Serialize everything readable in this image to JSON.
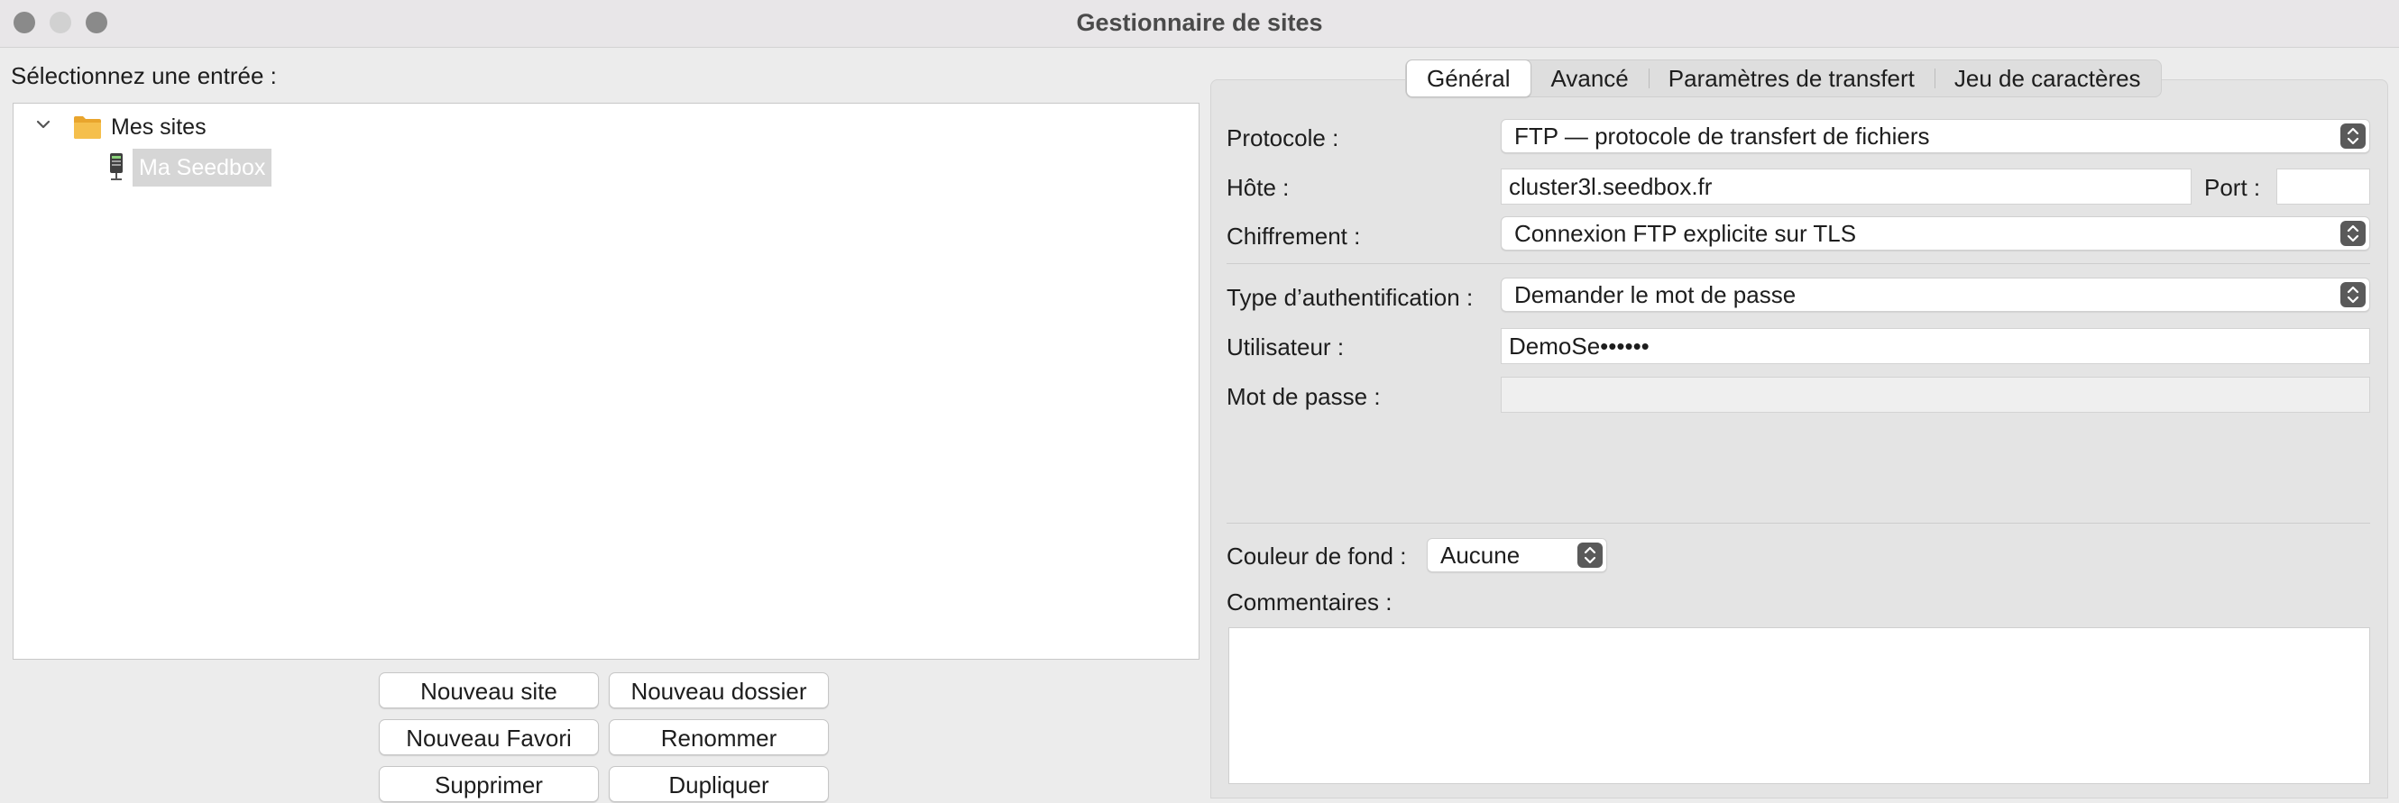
{
  "window": {
    "title": "Gestionnaire de sites"
  },
  "left": {
    "select_label": "Sélectionnez une entrée :",
    "tree": {
      "folder_label": "Mes sites",
      "site_label": "Ma Seedbox"
    },
    "buttons": {
      "new_site": "Nouveau site",
      "new_folder": "Nouveau dossier",
      "new_bookmark": "Nouveau Favori",
      "rename": "Renommer",
      "delete": "Supprimer",
      "duplicate": "Dupliquer"
    }
  },
  "tabs": [
    "Général",
    "Avancé",
    "Paramètres de transfert",
    "Jeu de caractères"
  ],
  "general": {
    "protocol_label": "Protocole :",
    "protocol_value": "FTP — protocole de transfert de fichiers",
    "host_label": "Hôte :",
    "host_value": "cluster3l.seedbox.fr",
    "port_label": "Port :",
    "port_value": "",
    "encryption_label": "Chiffrement :",
    "encryption_value": "Connexion FTP explicite sur TLS",
    "auth_label": "Type d’authentification :",
    "auth_value": "Demander le mot de passe",
    "user_label": "Utilisateur :",
    "user_value": "DemoSe••••••",
    "password_label": "Mot de passe :",
    "password_value": "",
    "bgcolor_label": "Couleur de fond :",
    "bgcolor_value": "Aucune",
    "comments_label": "Commentaires :",
    "comments_value": ""
  },
  "icons": {
    "chevron": "chevron-down-icon",
    "folder": "folder-icon",
    "site": "server-icon",
    "stepper": "up-down-stepper-icon"
  },
  "colors": {
    "folder": "#f2b33d",
    "selection": "#d6d6d6",
    "stepper": "#5a5a5a"
  }
}
